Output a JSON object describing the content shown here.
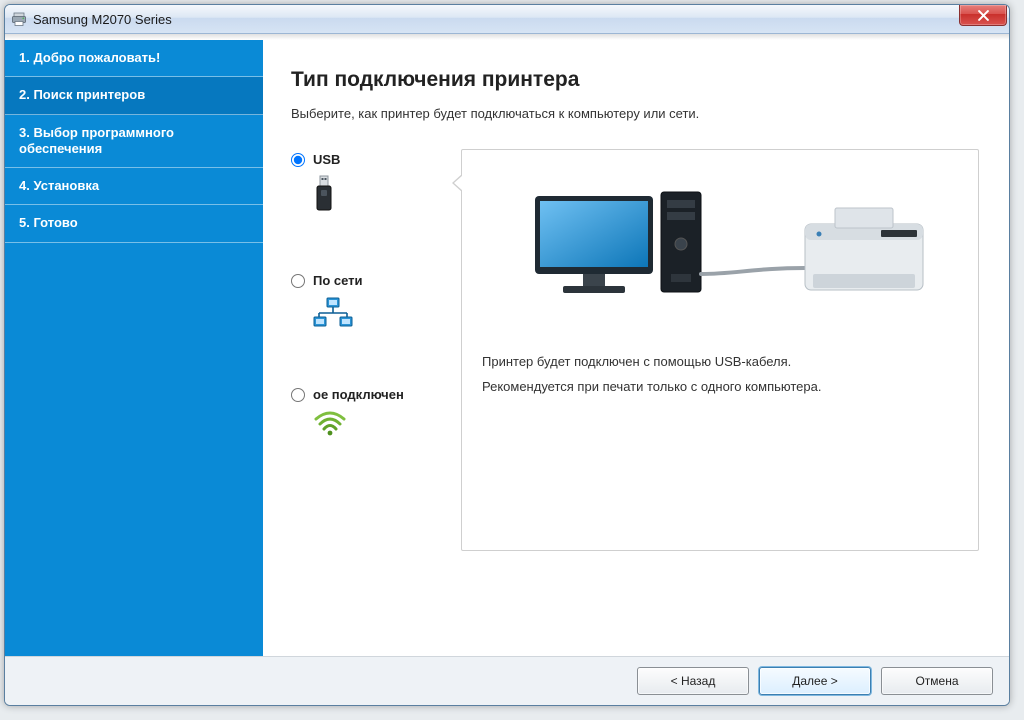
{
  "window": {
    "title": "Samsung M2070 Series"
  },
  "sidebar": {
    "items": [
      {
        "label": "1. Добро пожаловать!",
        "active": false
      },
      {
        "label": "2. Поиск принтеров",
        "active": true
      },
      {
        "label": "3. Выбор программного обеспечения",
        "active": false
      },
      {
        "label": "4. Установка",
        "active": false
      },
      {
        "label": "5. Готово",
        "active": false
      }
    ]
  },
  "page": {
    "title": "Тип подключения принтера",
    "subtitle": "Выберите, как принтер будет подключаться к компьютеру или сети."
  },
  "options": {
    "usb": {
      "label": "USB",
      "selected": true
    },
    "network": {
      "label": "По сети",
      "selected": false
    },
    "wireless": {
      "label": "ое подключен",
      "selected": false
    }
  },
  "preview": {
    "line1": "Принтер будет подключен с помощью USB-кабеля.",
    "line2": "Рекомендуется при печати только с одного компьютера."
  },
  "buttons": {
    "back": "< Назад",
    "next": "Далее >",
    "cancel": "Отмена"
  },
  "icons": {
    "app": "printer-icon",
    "close": "close-icon",
    "usb": "usb-stick-icon",
    "network": "network-icon",
    "wireless": "wifi-icon"
  }
}
